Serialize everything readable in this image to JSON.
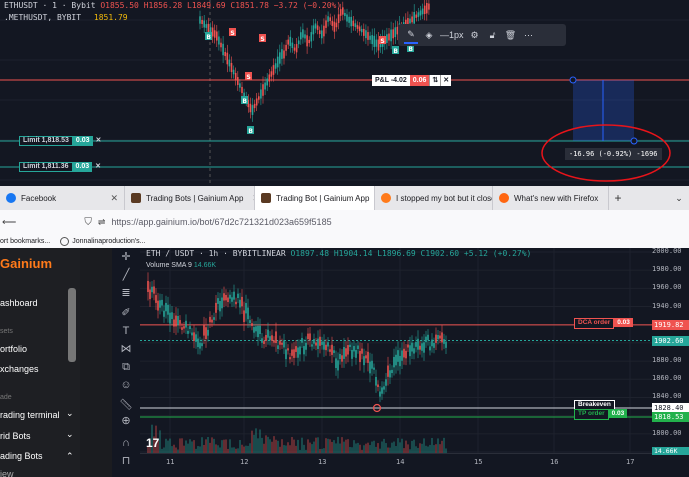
{
  "top_chart": {
    "symbol": "ETHUSDT · 1 · Bybit",
    "ohlc": "O1855.50 H1856.28 L1849.69 C1851.78 −3.72 (−0.20%)",
    "indicator_label": ".METHUSDT, BYBIT",
    "indicator_value": "1851.79",
    "toolbar": {
      "pen_icon": "pencil-icon",
      "fill_icon": "fill-icon",
      "width_label": "1px",
      "settings_icon": "gear-icon",
      "lock_icon": "lock-icon",
      "delete_icon": "trash-icon",
      "more_icon": "ellipsis-icon"
    },
    "pnl": {
      "label": "P&L -4.02",
      "value": "0.06",
      "sep": "⇅",
      "close": "✕"
    },
    "limits": [
      {
        "label": "Limit 1,818.53",
        "qty": "0.03",
        "close": "✕"
      },
      {
        "label": "Limit 1,811.36",
        "qty": "0.03",
        "close": "✕"
      }
    ],
    "measure": "-16.96 (-0.92%) -1696",
    "marker_b": "B",
    "marker_s": "S",
    "annotation_color": "#e8141a"
  },
  "browser": {
    "tabs": [
      {
        "title": "Facebook",
        "icon_color": "#1877f2",
        "close": "✕"
      },
      {
        "title": "Trading Bots | Gainium App",
        "icon_color": "#ff7a1a",
        "close": "✕"
      },
      {
        "title": "Trading Bot | Gainium App",
        "icon_color": "#ff7a1a",
        "close": "✕",
        "active": true
      },
      {
        "title": "I stopped my bot but it closed a",
        "icon_color": "#ff7a1a",
        "close": "✕"
      },
      {
        "title": "What's new with Firefox",
        "icon_color": "#ff6611",
        "close": "✕"
      }
    ],
    "new_tab": "+",
    "tab_menu": "⌄",
    "back": "⟵",
    "url": "https://app.gainium.io/bot/67d2c721321d023a659f5185",
    "bookmarks": [
      "ort bookmarks...",
      "Jonnalinaproduction's..."
    ]
  },
  "app": {
    "logo": "Gainium",
    "nav": [
      "ashboard",
      "ortfolio",
      "xchanges",
      "rading terminal",
      "rid Bots",
      "ading Bots",
      "iew"
    ],
    "sections": [
      "sets",
      "ade"
    ],
    "chevrons": [
      "⌄",
      "⌄",
      "⌃"
    ],
    "chart": {
      "title": "ETH / USDT · 1h · BYBITLINEAR",
      "ohlc": "O1897.48 H1904.14 L1896.69 C1902.60 +5.12 (+0.27%)",
      "volume_label": "Volume SMA 9",
      "volume_value": "14.66K",
      "y_ticks": [
        "2000.00",
        "1980.00",
        "1960.00",
        "1940.00",
        "1920.00",
        "1900.00",
        "1880.00",
        "1860.00",
        "1840.00",
        "1820.00",
        "1800.00",
        "1780.00"
      ],
      "x_ticks": [
        "11",
        "12",
        "13",
        "14",
        "15",
        "16",
        "17"
      ],
      "dca": {
        "label": "DCA order",
        "qty": "0.03",
        "price": "1919.82",
        "color": "#ef5350"
      },
      "current": {
        "price": "1902.60",
        "color": "#26a69a"
      },
      "breakeven": {
        "label": "Breakeven",
        "price": "1828.40"
      },
      "tp": {
        "label": "TP order",
        "qty": "0.03",
        "price": "1818.53",
        "color": "#22b14c"
      },
      "volume_tag": "14.66K",
      "tv_logo": "17"
    }
  }
}
